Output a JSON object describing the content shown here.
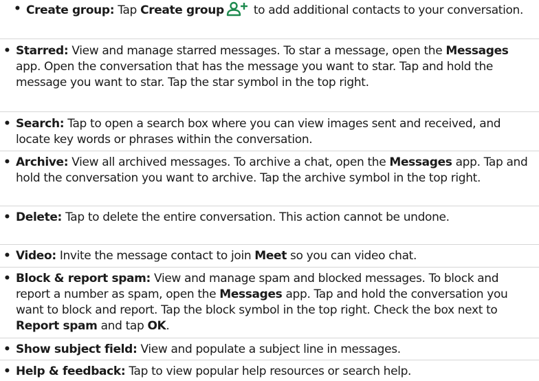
{
  "items": [
    {
      "id": "create-group",
      "bullet": "•",
      "term": "Create group:",
      "parts": [
        "Tap ",
        "Create group",
        " to add additional contacts to your conversation."
      ],
      "icon": "add-person-icon",
      "icon_color": "#1d8a4e"
    },
    {
      "id": "starred",
      "bullet": "•",
      "term": "Starred:",
      "parts": [
        " View and manage starred messages. To star a message, open the ",
        "Messages",
        " app. Open the conversation that has the message you want to star. Tap and hold the message you want to star. Tap the star symbol in the top right."
      ]
    },
    {
      "id": "search",
      "bullet": "•",
      "term": "Search:",
      "parts": [
        " Tap to open a search box where you can view images sent and received, and locate key words or phrases within the conversation."
      ]
    },
    {
      "id": "archive",
      "bullet": "•",
      "term": "Archive:",
      "parts": [
        " View all archived messages. To archive a chat, open the ",
        "Messages",
        " app. Tap and hold the conversation you want to archive. Tap the archive symbol in the top right."
      ]
    },
    {
      "id": "delete",
      "bullet": "•",
      "term": "Delete:",
      "parts": [
        " Tap to delete the entire conversation. This action cannot be undone."
      ]
    },
    {
      "id": "video",
      "bullet": "•",
      "term": "Video:",
      "parts": [
        " Invite the message contact to join ",
        "Meet",
        " so you can video chat."
      ]
    },
    {
      "id": "block",
      "bullet": "•",
      "term": "Block & report spam:",
      "parts": [
        " View and manage spam and blocked messages. To block and report a number as spam, open the ",
        "Messages",
        " app. Tap and hold the conversation you want to block and report. Tap the block symbol in the top right. Check the box next to ",
        "Report spam",
        " and tap ",
        "OK",
        "."
      ]
    },
    {
      "id": "subject",
      "bullet": "•",
      "term": "Show subject field:",
      "parts": [
        " View and populate a subject line in messages."
      ]
    },
    {
      "id": "help",
      "bullet": "•",
      "term": "Help & feedback:",
      "parts": [
        " Tap to view popular help resources or search help."
      ]
    }
  ]
}
